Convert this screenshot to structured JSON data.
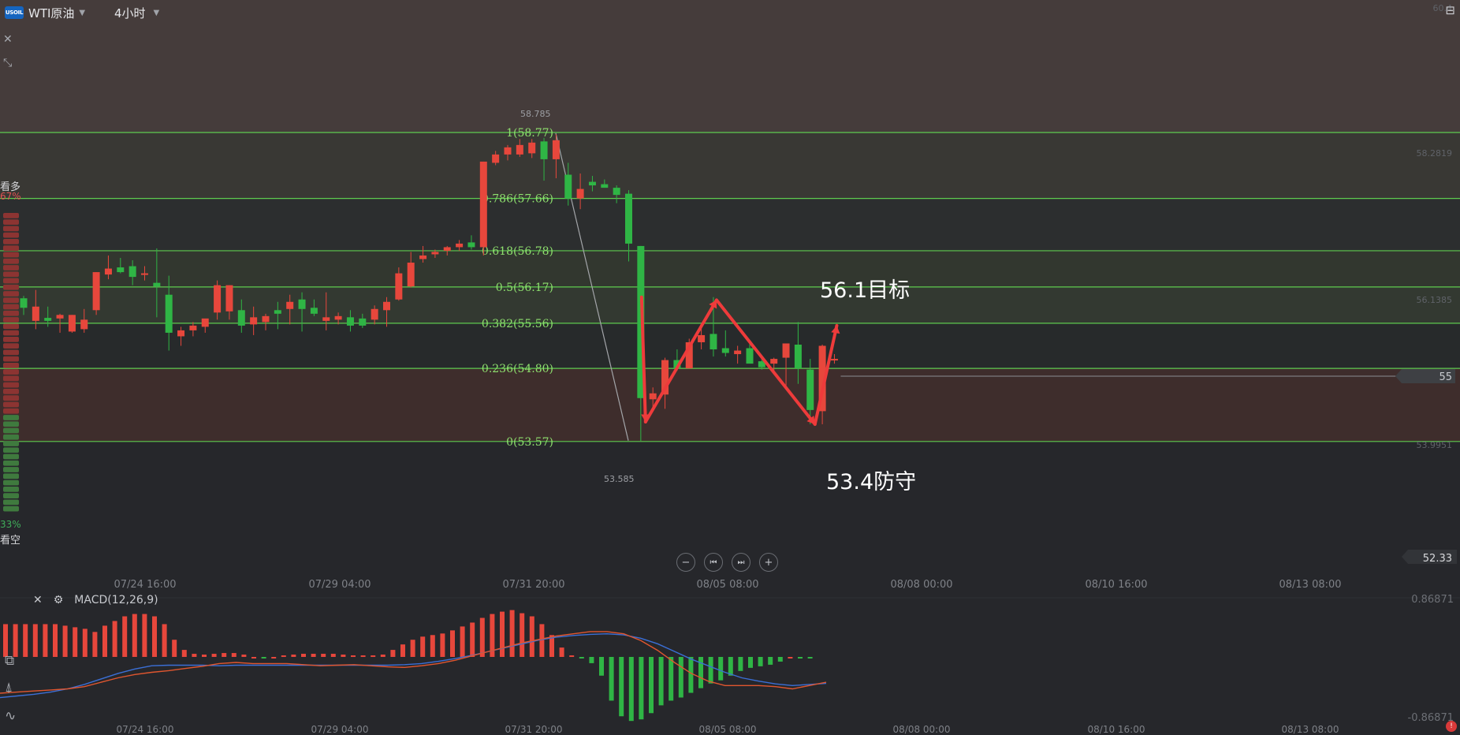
{
  "header": {
    "symbol_logo": "USOIL",
    "symbol": "WTI原油",
    "timeframe": "4小时",
    "icons": [
      "close-icon",
      "collapse-icon",
      "sidebar-toggle-icon"
    ]
  },
  "sentiment": {
    "bull_label": "看多",
    "bull_pct": "67%",
    "bear_label": "看空",
    "bear_pct": "33%",
    "bull_share": 0.67
  },
  "nav_buttons": [
    "−",
    "⏮",
    "⏭",
    "+"
  ],
  "macd": {
    "label": "MACD(12,26,9)",
    "axis_top": "0.86871",
    "axis_bottom": "-0.86871",
    "histogram": [
      0.42,
      0.42,
      0.42,
      0.42,
      0.42,
      0.42,
      0.4,
      0.38,
      0.36,
      0.32,
      0.4,
      0.46,
      0.52,
      0.55,
      0.55,
      0.52,
      0.42,
      0.22,
      0.09,
      0.04,
      0.03,
      0.04,
      0.05,
      0.05,
      0.03,
      0.0,
      -0.01,
      0.0,
      0.02,
      0.03,
      0.04,
      0.04,
      0.04,
      0.04,
      0.03,
      0.02,
      0.02,
      0.02,
      0.03,
      0.09,
      0.16,
      0.22,
      0.26,
      0.28,
      0.3,
      0.34,
      0.39,
      0.44,
      0.5,
      0.55,
      0.58,
      0.6,
      0.56,
      0.52,
      0.42,
      0.28,
      0.12,
      0.02,
      -0.02,
      -0.08,
      -0.24,
      -0.56,
      -0.76,
      -0.82,
      -0.8,
      -0.72,
      -0.62,
      -0.56,
      -0.52,
      -0.46,
      -0.4,
      -0.34,
      -0.3,
      -0.24,
      -0.18,
      -0.14,
      -0.12,
      -0.1,
      -0.06,
      0.0,
      -0.02,
      -0.01
    ],
    "dif": [
      -0.66,
      -0.64,
      -0.62,
      -0.6,
      -0.58,
      -0.54,
      -0.46,
      -0.38,
      -0.32,
      -0.28,
      -0.25,
      -0.21,
      -0.17,
      -0.12,
      -0.1,
      -0.12,
      -0.12,
      -0.12,
      -0.14,
      -0.16,
      -0.15,
      -0.14,
      -0.16,
      -0.18,
      -0.19,
      -0.16,
      -0.12,
      -0.06,
      0.02,
      0.1,
      0.18,
      0.26,
      0.32,
      0.38,
      0.42,
      0.46,
      0.46,
      0.42,
      0.3,
      0.12,
      -0.1,
      -0.3,
      -0.44,
      -0.52,
      -0.52,
      -0.52,
      -0.54,
      -0.58,
      -0.52,
      -0.46
    ],
    "dea": [
      -0.74,
      -0.71,
      -0.68,
      -0.64,
      -0.58,
      -0.5,
      -0.4,
      -0.3,
      -0.22,
      -0.16,
      -0.15,
      -0.15,
      -0.15,
      -0.16,
      -0.15,
      -0.15,
      -0.15,
      -0.15,
      -0.15,
      -0.15,
      -0.15,
      -0.15,
      -0.15,
      -0.15,
      -0.14,
      -0.12,
      -0.08,
      -0.03,
      0.03,
      0.1,
      0.17,
      0.24,
      0.31,
      0.36,
      0.39,
      0.41,
      0.42,
      0.4,
      0.34,
      0.24,
      0.1,
      -0.04,
      -0.16,
      -0.28,
      -0.38,
      -0.44,
      -0.49,
      -0.52,
      -0.5,
      -0.48
    ],
    "time_labels": [
      "07/24 16:00",
      "07/29 04:00",
      "07/31 20:00",
      "08/05 08:00",
      "08/08 00:00",
      "08/10 16:00",
      "08/13 08:00"
    ]
  },
  "annotations": {
    "target": "56.1目标",
    "defense": "53.4防守",
    "high_label": "58.785",
    "low_label": "53.585"
  },
  "chart_data": {
    "type": "candlestick",
    "title": "WTI原油 4小时",
    "x_labels": [
      "07/24 16:00",
      "07/29 04:00",
      "07/31 20:00",
      "08/05 08:00",
      "08/08 00:00",
      "08/10 16:00",
      "08/13 08:00"
    ],
    "y_axis_labels": [
      "60.4",
      "58.2819",
      "56.1385",
      "55",
      "53.9951",
      "52.33"
    ],
    "last_price_label": "55",
    "ylim": [
      51.55,
      61.0
    ],
    "fibonacci": [
      {
        "ratio": "1",
        "price": "58.77",
        "value": 58.77
      },
      {
        "ratio": "0.786",
        "price": "57.66",
        "value": 57.66
      },
      {
        "ratio": "0.618",
        "price": "56.78",
        "value": 56.78
      },
      {
        "ratio": "0.5",
        "price": "56.17",
        "value": 56.17
      },
      {
        "ratio": "0.382",
        "price": "55.56",
        "value": 55.56
      },
      {
        "ratio": "0.236",
        "price": "54.80",
        "value": 54.8
      },
      {
        "ratio": "0",
        "price": "53.57",
        "value": 53.57
      }
    ],
    "candles": [
      [
        55.98,
        56.02,
        55.7,
        55.82
      ],
      [
        55.6,
        56.12,
        55.46,
        55.84
      ],
      [
        55.65,
        55.84,
        55.5,
        55.6
      ],
      [
        55.64,
        55.72,
        55.4,
        55.7
      ],
      [
        55.42,
        55.7,
        55.4,
        55.7
      ],
      [
        55.46,
        55.8,
        55.4,
        55.62
      ],
      [
        55.78,
        56.42,
        55.7,
        56.42
      ],
      [
        56.38,
        56.7,
        56.3,
        56.48
      ],
      [
        56.5,
        56.66,
        56.4,
        56.42
      ],
      [
        56.52,
        56.62,
        56.2,
        56.34
      ],
      [
        56.38,
        56.52,
        56.28,
        56.4
      ],
      [
        56.24,
        56.82,
        55.66,
        56.18
      ],
      [
        56.04,
        56.36,
        55.1,
        55.4
      ],
      [
        55.34,
        55.5,
        55.18,
        55.44
      ],
      [
        55.44,
        55.58,
        55.34,
        55.52
      ],
      [
        55.5,
        55.6,
        55.4,
        55.64
      ],
      [
        55.74,
        56.28,
        55.62,
        56.2
      ],
      [
        55.76,
        56.2,
        55.62,
        56.2
      ],
      [
        55.78,
        55.96,
        55.4,
        55.52
      ],
      [
        55.54,
        55.84,
        55.36,
        55.66
      ],
      [
        55.58,
        55.72,
        55.44,
        55.68
      ],
      [
        55.78,
        55.92,
        55.46,
        55.72
      ],
      [
        55.8,
        56.04,
        55.54,
        55.92
      ],
      [
        55.96,
        56.08,
        55.42,
        55.8
      ],
      [
        55.82,
        55.96,
        55.68,
        55.72
      ],
      [
        55.6,
        56.08,
        55.44,
        55.66
      ],
      [
        55.62,
        55.74,
        55.54,
        55.68
      ],
      [
        55.66,
        55.78,
        55.42,
        55.52
      ],
      [
        55.64,
        55.72,
        55.48,
        55.52
      ],
      [
        55.62,
        55.86,
        55.54,
        55.8
      ],
      [
        55.78,
        56.0,
        55.5,
        55.92
      ],
      [
        55.96,
        56.5,
        55.94,
        56.4
      ],
      [
        56.18,
        56.76,
        56.16,
        56.58
      ],
      [
        56.64,
        56.86,
        56.58,
        56.7
      ],
      [
        56.72,
        56.8,
        56.66,
        56.76
      ],
      [
        56.78,
        56.86,
        56.7,
        56.84
      ],
      [
        56.84,
        56.96,
        56.78,
        56.9
      ],
      [
        56.92,
        57.04,
        56.8,
        56.84
      ],
      [
        56.84,
        58.28,
        56.7,
        58.28
      ],
      [
        58.26,
        58.46,
        58.22,
        58.4
      ],
      [
        58.4,
        58.56,
        58.3,
        58.52
      ],
      [
        58.4,
        58.66,
        58.36,
        58.56
      ],
      [
        58.42,
        58.66,
        58.34,
        58.6
      ],
      [
        58.62,
        58.68,
        57.96,
        58.32
      ],
      [
        58.32,
        58.74,
        58.0,
        58.64
      ],
      [
        58.06,
        58.26,
        57.54,
        57.66
      ],
      [
        57.66,
        58.08,
        57.48,
        57.82
      ],
      [
        57.94,
        58.04,
        57.78,
        57.88
      ],
      [
        57.9,
        57.98,
        57.84,
        57.84
      ],
      [
        57.84,
        57.88,
        57.58,
        57.72
      ],
      [
        57.74,
        57.8,
        56.6,
        56.9
      ],
      [
        56.86,
        56.86,
        53.58,
        54.3
      ],
      [
        54.28,
        54.48,
        54.12,
        54.38
      ],
      [
        54.36,
        54.98,
        54.12,
        54.94
      ],
      [
        54.94,
        55.12,
        54.76,
        54.8
      ],
      [
        54.8,
        55.3,
        54.8,
        55.24
      ],
      [
        55.24,
        55.5,
        55.12,
        55.36
      ],
      [
        55.38,
        56.0,
        55.0,
        55.12
      ],
      [
        55.14,
        55.44,
        55.0,
        55.06
      ],
      [
        55.04,
        55.18,
        54.88,
        55.1
      ],
      [
        55.14,
        55.24,
        54.92,
        54.88
      ],
      [
        54.92,
        55.02,
        54.78,
        54.82
      ],
      [
        54.88,
        54.98,
        54.74,
        54.96
      ],
      [
        54.98,
        55.16,
        54.44,
        55.22
      ],
      [
        55.2,
        55.58,
        54.54,
        54.8
      ],
      [
        54.78,
        54.96,
        53.86,
        54.1
      ],
      [
        54.08,
        55.2,
        53.86,
        55.18
      ],
      [
        54.94,
        55.04,
        54.88,
        54.96
      ]
    ]
  }
}
